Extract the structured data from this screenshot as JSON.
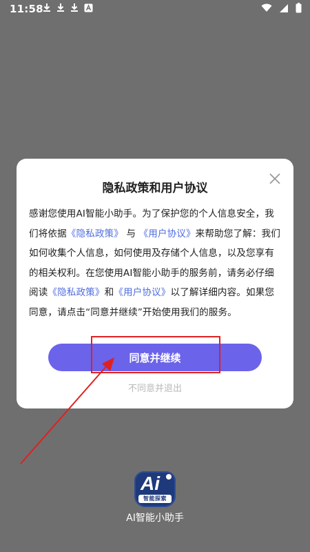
{
  "status_bar": {
    "time": "11:58",
    "left_icons": [
      "download-icon",
      "download-icon",
      "download-icon",
      "app-a-icon"
    ],
    "right_icons": [
      "wifi-icon",
      "cell-signal-icon",
      "battery-icon"
    ]
  },
  "dialog": {
    "title": "隐私政策和用户协议",
    "close_icon": "close-icon",
    "body": {
      "p1": "感谢您使用AI智能小助手。为了保护您的个人信息安全，我们将依据",
      "link_privacy_1": "《隐私政策》",
      "p2": " 与 ",
      "link_user_1": "《用户协议》",
      "p3": "来帮助您了解：我们如何收集个人信息，如何使用及存储个人信息，以及您享有的相关权利。在您使用AI智能小助手的服务前，请务必仔细阅读",
      "link_privacy_2": "《隐私政策》",
      "p4": "和",
      "link_user_2": "《用户协议》",
      "p5": "以了解详细内容。如果您同意，请点击“同意并继续”开始使用我们的服务。"
    },
    "agree_label": "同意并继续",
    "disagree_label": "不同意并退出"
  },
  "app_splash": {
    "logo_text": "Ai",
    "logo_badge": "智能探索",
    "app_name": "AI智能小助手"
  },
  "colors": {
    "accent": "#6b63e9",
    "link": "#4f6de0",
    "annotation": "#e02020",
    "overlay": "#6f6f6f"
  }
}
